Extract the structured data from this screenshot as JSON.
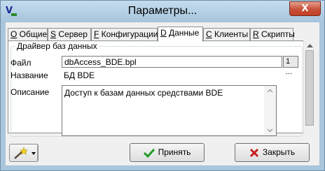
{
  "window": {
    "title": "Параметры..."
  },
  "tabs": [
    {
      "key": "O",
      "label": " Общие"
    },
    {
      "key": "S",
      "label": " Сервер"
    },
    {
      "key": "F",
      "label": " Конфигурации"
    },
    {
      "key": "D",
      "label": " Данные"
    },
    {
      "key": "C",
      "label": " Клиенты"
    },
    {
      "key": "R",
      "label": " Скрипты"
    }
  ],
  "group": {
    "title": "Драйвер баз данных"
  },
  "fields": {
    "file_label": "Файл",
    "file_value": "dbAccess_BDE.bpl",
    "browse_label": "1 ...",
    "name_label": "Название",
    "name_value": "БД BDE",
    "desc_label": "Описание",
    "desc_value": "Доступ к базам данных средствами BDE"
  },
  "buttons": {
    "accept": "Принять",
    "close": "Закрыть",
    "window_close": "X"
  },
  "colors": {
    "accept_icon": "#1e9b24",
    "close_icon": "#c81e1e"
  }
}
